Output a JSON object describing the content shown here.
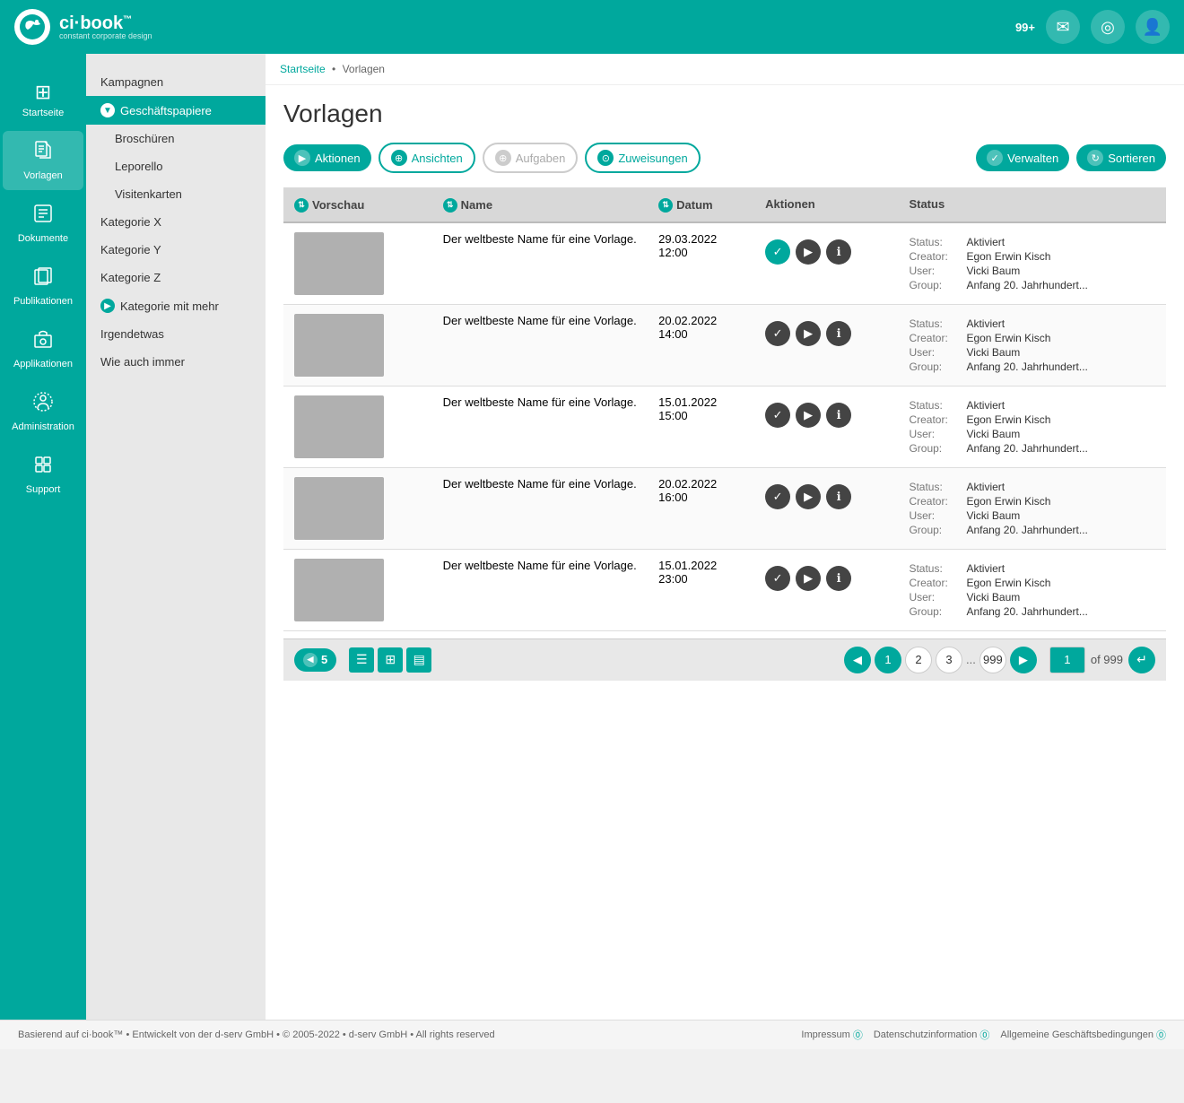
{
  "app": {
    "name": "ci·book",
    "trademark": "™",
    "subtitle": "constant corporate design"
  },
  "topbar": {
    "notification_count": "99+",
    "icons": [
      "envelope-icon",
      "compass-icon",
      "user-icon"
    ]
  },
  "sidebar": {
    "items": [
      {
        "id": "startseite",
        "label": "Startseite",
        "icon": "⊞"
      },
      {
        "id": "vorlagen",
        "label": "Vorlagen",
        "icon": "📄",
        "active": true
      },
      {
        "id": "dokumente",
        "label": "Dokumente",
        "icon": "📋"
      },
      {
        "id": "publikationen",
        "label": "Publikationen",
        "icon": "📦"
      },
      {
        "id": "applikationen",
        "label": "Applikationen",
        "icon": "🖨"
      },
      {
        "id": "administration",
        "label": "Administration",
        "icon": "⚙"
      },
      {
        "id": "support",
        "label": "Support",
        "icon": "➕"
      }
    ]
  },
  "secondary_sidebar": {
    "items": [
      {
        "label": "Kampagnen",
        "active": false,
        "expandable": false
      },
      {
        "label": "Geschäftspapiere",
        "active": true,
        "expandable": true
      },
      {
        "label": "Broschüren",
        "active": false,
        "expandable": false
      },
      {
        "label": "Leporello",
        "active": false,
        "expandable": false
      },
      {
        "label": "Visitenkarten",
        "active": false,
        "expandable": false
      },
      {
        "label": "Kategorie X",
        "active": false,
        "expandable": false
      },
      {
        "label": "Kategorie Y",
        "active": false,
        "expandable": false
      },
      {
        "label": "Kategorie Z",
        "active": false,
        "expandable": false
      },
      {
        "label": "Kategorie mit mehr",
        "active": false,
        "expandable": true
      },
      {
        "label": "Irgendetwas",
        "active": false,
        "expandable": false
      },
      {
        "label": "Wie auch immer",
        "active": false,
        "expandable": false
      }
    ]
  },
  "breadcrumb": {
    "items": [
      "Startseite",
      "Vorlagen"
    ],
    "separator": "•"
  },
  "page": {
    "title": "Vorlagen"
  },
  "toolbar": {
    "buttons": [
      {
        "label": "Aktionen",
        "style": "teal",
        "icon": "▶"
      },
      {
        "label": "Ansichten",
        "style": "teal-outline",
        "icon": "⊕"
      },
      {
        "label": "Aufgaben",
        "style": "gray-outline",
        "icon": "⊕"
      },
      {
        "label": "Zuweisungen",
        "style": "teal-outline",
        "icon": "⊙"
      }
    ],
    "right_buttons": [
      {
        "label": "Verwalten",
        "icon": "✓"
      },
      {
        "label": "Sortieren",
        "icon": "↻"
      }
    ]
  },
  "table": {
    "columns": [
      {
        "label": "Vorschau",
        "sortable": true
      },
      {
        "label": "Name",
        "sortable": true
      },
      {
        "label": "Datum",
        "sortable": true
      },
      {
        "label": "Aktionen",
        "sortable": false
      },
      {
        "label": "Status",
        "sortable": false
      }
    ],
    "rows": [
      {
        "name": "Der weltbeste Name für eine Vorlage.",
        "date": "29.03.2022",
        "time": "12:00",
        "status": "Aktiviert",
        "creator": "Egon Erwin Kisch",
        "user": "Vicki Baum",
        "group": "Anfang 20. Jahrhundert...",
        "action_check": true
      },
      {
        "name": "Der weltbeste Name für eine Vorlage.",
        "date": "20.02.2022",
        "time": "14:00",
        "status": "Aktiviert",
        "creator": "Egon Erwin Kisch",
        "user": "Vicki Baum",
        "group": "Anfang 20. Jahrhundert...",
        "action_check": false
      },
      {
        "name": "Der weltbeste Name für eine Vorlage.",
        "date": "15.01.2022",
        "time": "15:00",
        "status": "Aktiviert",
        "creator": "Egon Erwin Kisch",
        "user": "Vicki Baum",
        "group": "Anfang 20. Jahrhundert...",
        "action_check": false
      },
      {
        "name": "Der weltbeste Name für eine Vorlage.",
        "date": "20.02.2022",
        "time": "16:00",
        "status": "Aktiviert",
        "creator": "Egon Erwin Kisch",
        "user": "Vicki Baum",
        "group": "Anfang 20. Jahrhundert...",
        "action_check": false
      },
      {
        "name": "Der weltbeste Name für eine Vorlage.",
        "date": "15.01.2022",
        "time": "23:00",
        "status": "Aktiviert",
        "creator": "Egon Erwin Kisch",
        "user": "Vicki Baum",
        "group": "Anfang 20. Jahrhundert...",
        "action_check": false
      }
    ]
  },
  "pagination": {
    "per_page": "5",
    "current_page": "1",
    "pages": [
      "1",
      "2",
      "3",
      "...",
      "999"
    ],
    "total": "999",
    "of_label": "of",
    "input_value": "1"
  },
  "status_labels": {
    "status": "Status:",
    "creator": "Creator:",
    "user": "User:",
    "group": "Group:"
  },
  "footer": {
    "copyright": "Basierend auf ci·book™ • Entwickelt von der d-serv GmbH • © 2005-2022 • d-serv GmbH • All rights reserved",
    "links": [
      {
        "label": "Impressum"
      },
      {
        "label": "Datenschutzinformation"
      },
      {
        "label": "Allgemeine Geschäftsbedingungen"
      }
    ]
  }
}
